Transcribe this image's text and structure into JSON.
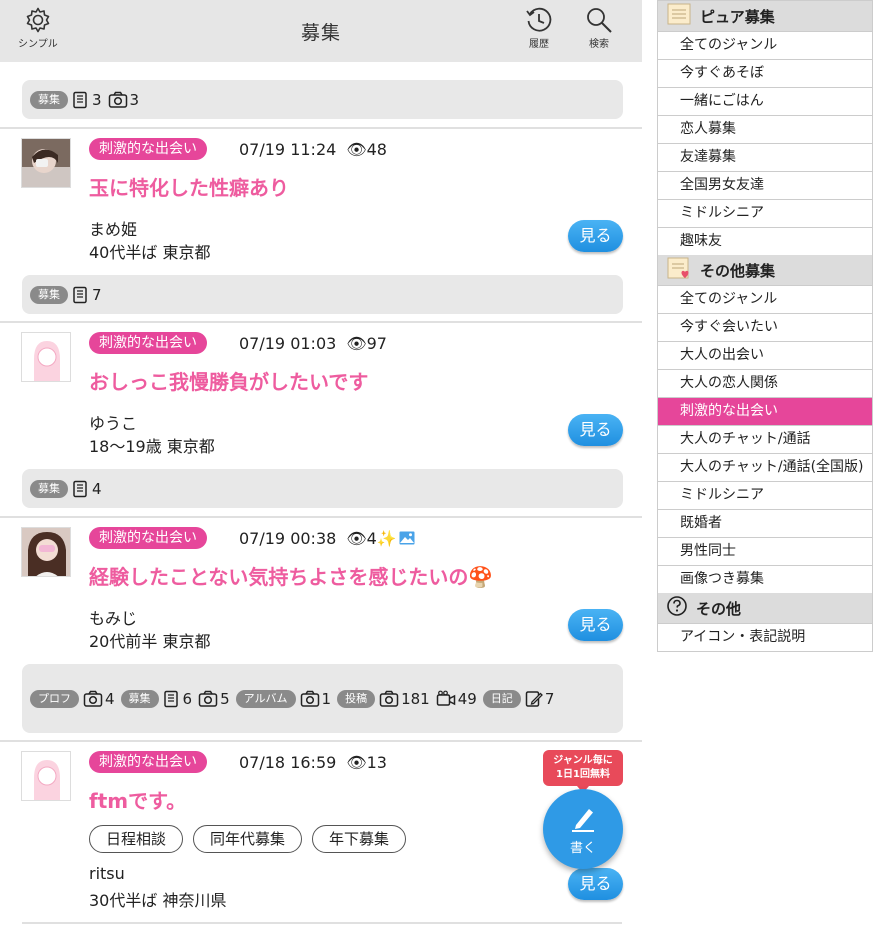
{
  "header": {
    "left_label": "シンプル",
    "title": "募集",
    "history_label": "履歴",
    "search_label": "検索"
  },
  "feed": {
    "top_stats": {
      "pill": "募集",
      "count1": "3",
      "count2": "3"
    },
    "posts": [
      {
        "genre": "刺激的な出会い",
        "date": "07/19 11:24",
        "views": "48",
        "title": "玉に特化した性癖あり",
        "name": "まめ姫",
        "info": "40代半ば 東京都",
        "see": "見る",
        "stats": {
          "pill": "募集",
          "count": "7"
        }
      },
      {
        "genre": "刺激的な出会い",
        "date": "07/19 01:03",
        "views": "97",
        "title": "おしっこ我慢勝負がしたいです",
        "name": "ゆうこ",
        "info": "18〜19歳 東京都",
        "see": "見る",
        "stats": {
          "pill": "募集",
          "count": "4"
        }
      },
      {
        "genre": "刺激的な出会い",
        "date": "07/19 00:38",
        "views": "4",
        "title": "経験したことない気持ちよさを感じたいの🍄",
        "name": "もみじ",
        "info": "20代前半 東京都",
        "see": "見る",
        "stats": {
          "pill_prof": "プロフ",
          "prof_photo": "4",
          "pill_bosyu": "募集",
          "bosyu_memo": "6",
          "bosyu_photo": "5",
          "pill_album": "アルバム",
          "album_photo": "1",
          "pill_post": "投稿",
          "post_photo": "181",
          "post_video": "49",
          "pill_diary": "日記",
          "diary_count": "7"
        }
      },
      {
        "genre": "刺激的な出会い",
        "date": "07/18 16:59",
        "views": "13",
        "title": "ftmです。",
        "tags": [
          "日程相談",
          "同年代募集",
          "年下募集"
        ],
        "name": "ritsu",
        "info": "30代半ば 神奈川県",
        "see": "見る"
      }
    ],
    "fab": {
      "badge_line1": "ジャンル毎に",
      "badge_line2": "1日1回無料",
      "label": "書く"
    }
  },
  "sidebar": {
    "pure_title": "ピュア募集",
    "pure_items": [
      "全てのジャンル",
      "今すぐあそぼ",
      "一緒にごはん",
      "恋人募集",
      "友達募集",
      "全国男女友達",
      "ミドルシニア",
      "趣味友"
    ],
    "other_title": "その他募集",
    "other_items": [
      "全てのジャンル",
      "今すぐ会いたい",
      "大人の出会い",
      "大人の恋人関係",
      "刺激的な出会い",
      "大人のチャット/通話",
      "大人のチャット/通話(全国版)",
      "ミドルシニア",
      "既婚者",
      "男性同士",
      "画像つき募集"
    ],
    "misc_title": "その他",
    "misc_items": [
      "アイコン・表記説明"
    ],
    "active_color": "#e6469a"
  }
}
